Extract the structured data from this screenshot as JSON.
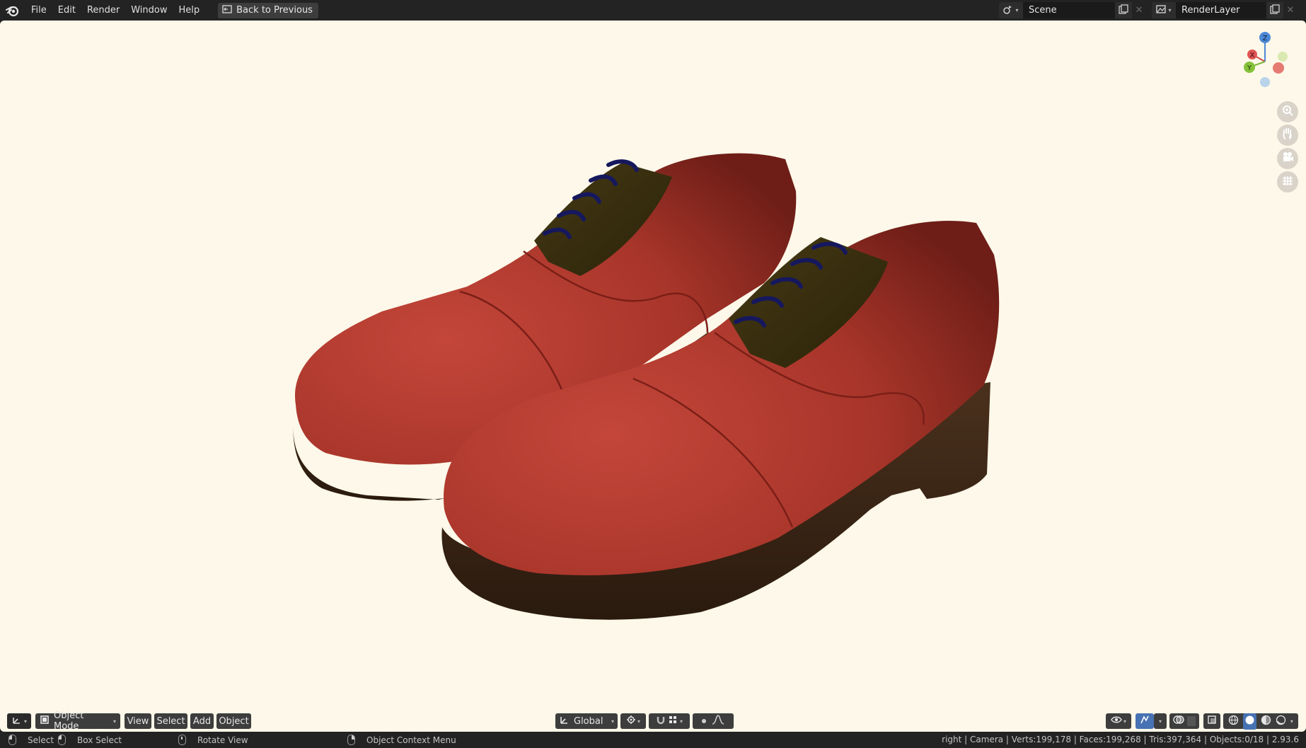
{
  "topbar": {
    "menu": [
      "File",
      "Edit",
      "Render",
      "Window",
      "Help"
    ],
    "back_button": "Back to Previous",
    "scene_name": "Scene",
    "render_layer": "RenderLayer"
  },
  "viewport": {
    "background": "#fdf8e9",
    "gizmo": {
      "z": "Z",
      "x": "X",
      "y": "Y"
    },
    "nav_tools": [
      "zoom-icon",
      "hand-icon",
      "camera-icon",
      "grid-icon"
    ]
  },
  "header": {
    "mode": "Object Mode",
    "menus": [
      "View",
      "Select",
      "Add",
      "Object"
    ],
    "transform_orientation": "Global"
  },
  "statusbar": {
    "select": "Select",
    "box_select": "Box Select",
    "rotate_view": "Rotate View",
    "context_menu": "Object Context Menu",
    "stats": "right | Camera | Verts:199,178 | Faces:199,268 | Tris:397,364 | Objects:0/18 | 2.93.6"
  },
  "colors": {
    "leather": "#a8352a",
    "sole": "#3c2616",
    "tongue": "#3a2f10",
    "laces": "#16185e",
    "accent": "#4772b3"
  }
}
